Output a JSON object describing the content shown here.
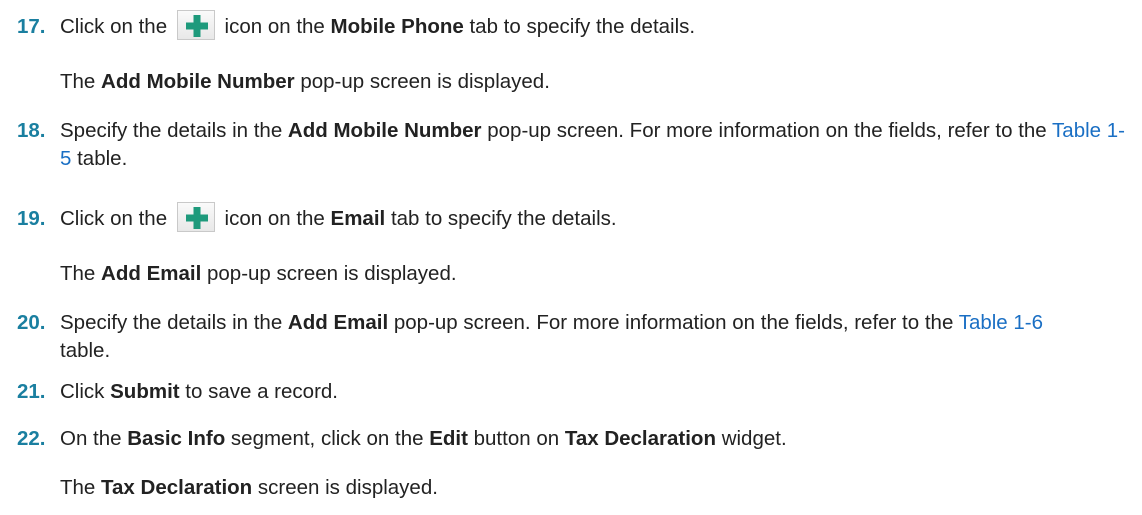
{
  "steps": [
    {
      "number": "17.",
      "text_a": "Click on the",
      "icon": "plus-icon",
      "text_b": "icon on the",
      "bold_1": "Mobile Phone",
      "text_c": "tab to specify the details."
    },
    {
      "text_a": "The",
      "bold_1": "Add Mobile Number",
      "text_b": "pop-up screen is displayed."
    },
    {
      "number": "18.",
      "text_a": "Specify the details in the",
      "bold_1": "Add Mobile Number",
      "text_b": "pop-up screen. For more information on the fields, refer to the",
      "link": "Table 1-5",
      "text_c": "table."
    },
    {
      "number": "19.",
      "text_a": "Click on the",
      "icon": "plus-icon",
      "text_b": "icon on the",
      "bold_1": "Email",
      "text_c": "tab to specify the details."
    },
    {
      "text_a": "The",
      "bold_1": "Add Email",
      "text_b": "pop-up screen is displayed."
    },
    {
      "number": "20.",
      "text_a": "Specify the details in the",
      "bold_1": "Add Email",
      "text_b": "pop-up screen. For more information on the fields, refer to the",
      "link": "Table 1-6",
      "text_c": "table."
    },
    {
      "number": "21.",
      "text_a": "Click",
      "bold_1": "Submit",
      "text_b": "to save a record."
    },
    {
      "number": "22.",
      "text_a": "On the",
      "bold_1": "Basic Info",
      "text_b": "segment, click on the",
      "bold_2": "Edit",
      "text_c": "button on",
      "bold_3": "Tax Declaration",
      "text_d": "widget."
    },
    {
      "text_a": "The",
      "bold_1": "Tax Declaration",
      "text_b": "screen is displayed."
    }
  ],
  "colors": {
    "step_number": "#1a7fa0",
    "link": "#1a6fc4",
    "plus_icon": "#1e9a7c",
    "text": "#222222"
  }
}
